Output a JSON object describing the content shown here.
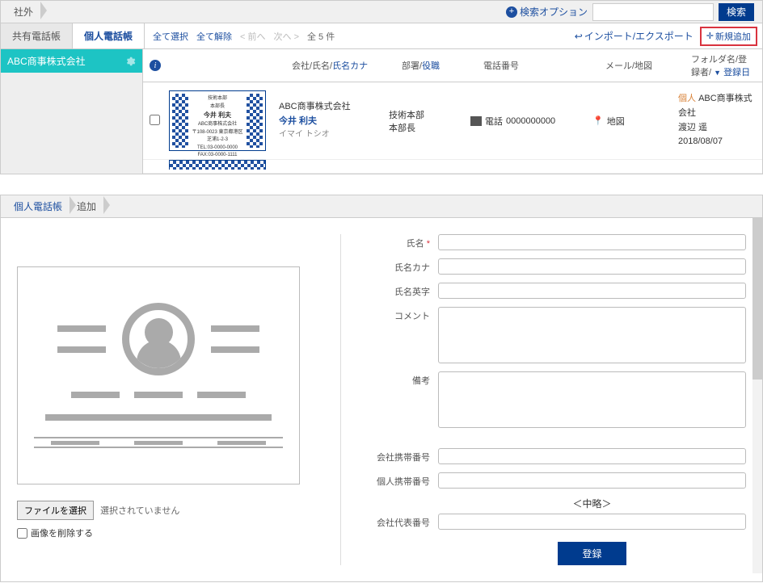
{
  "breadcrumb": {
    "location": "社外"
  },
  "search": {
    "option_label": "検索オプション",
    "button": "検索",
    "placeholder": ""
  },
  "tabs": {
    "shared": "共有電話帳",
    "personal": "個人電話帳"
  },
  "toolbar": {
    "select_all": "全て選択",
    "deselect_all": "全て解除",
    "prev": "前へ",
    "next": "次へ",
    "count": "全 5 件",
    "import_export": "インポート/エクスポート",
    "add_new": "新規追加"
  },
  "sidebar": {
    "items": [
      {
        "label": "ABC商事株式会社"
      }
    ]
  },
  "table": {
    "headers": {
      "company_name": "会社/氏名/",
      "kana": "氏名カナ",
      "dept": "部署/",
      "role": "役職",
      "phone": "電話番号",
      "mail_map": "メール/地図",
      "folder": "フォルダ名/登録者/",
      "regdate": "登録日"
    },
    "rows": [
      {
        "card": {
          "dept": "技術本部",
          "title": "本部長",
          "name": "今井 利夫",
          "company": "ABC商事株式会社",
          "addr": "〒108-0023 東京都港区芝浦1-2-3",
          "tel": "TEL:03-0000-0000  FAX:03-0000-1111"
        },
        "company": "ABC商事株式会社",
        "name": "今井 利夫",
        "kana": "イマイ トシオ",
        "dept": "技術本部",
        "role": "本部長",
        "phone_label": "電話",
        "phone": "0000000000",
        "map_label": "地図",
        "tag": "個人",
        "folder_company": "ABC商事株式会社",
        "registrant": "渡辺 遥",
        "date": "2018/08/07"
      }
    ]
  },
  "form": {
    "breadcrumb1": "個人電話帳",
    "breadcrumb2": "追加",
    "labels": {
      "name": "氏名",
      "kana": "氏名カナ",
      "eiji": "氏名英字",
      "comment": "コメント",
      "note": "備考",
      "company_mobile": "会社携帯番号",
      "personal_mobile": "個人携帯番号",
      "company_main": "会社代表番号"
    },
    "omitted": "＜中略＞",
    "file_button": "ファイルを選択",
    "file_status": "選択されていません",
    "delete_image": "画像を削除する",
    "submit": "登録"
  }
}
